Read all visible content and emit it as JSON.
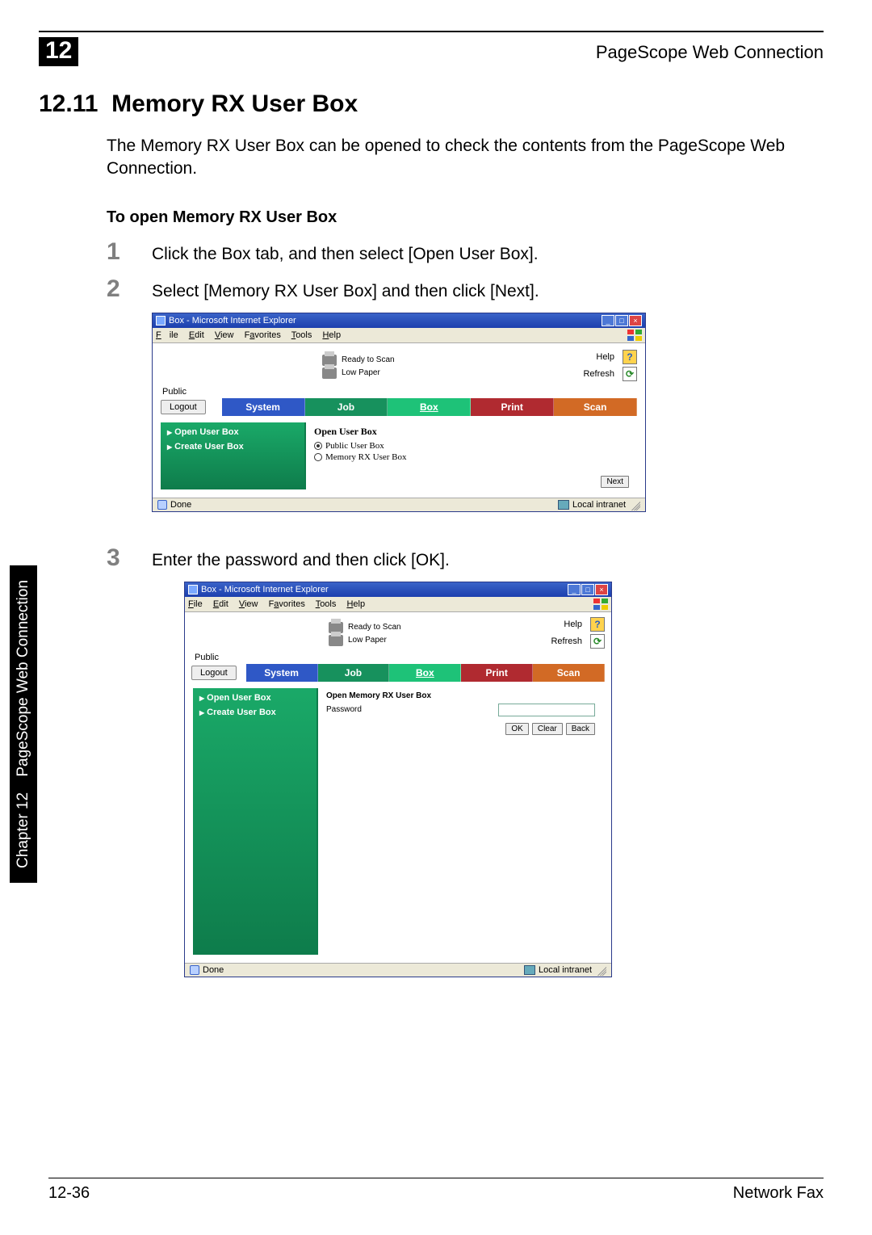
{
  "header": {
    "chapterNumber": "12",
    "right": "PageScope Web Connection"
  },
  "section": {
    "number": "12.11",
    "title": "Memory RX User Box",
    "intro": "The Memory RX User Box can be opened to check the contents from the PageScope Web Connection.",
    "subheading": "To open Memory RX User Box"
  },
  "steps": {
    "s1": {
      "num": "1",
      "text": "Click the Box tab, and then select [Open User Box]."
    },
    "s2": {
      "num": "2",
      "text": "Select [Memory RX User Box] and then click [Next]."
    },
    "s3": {
      "num": "3",
      "text": "Enter the password and then click [OK]."
    }
  },
  "browser": {
    "title": "Box - Microsoft Internet Explorer",
    "menus": {
      "file": "File",
      "edit": "Edit",
      "view": "View",
      "favorites": "Favorites",
      "tools": "Tools",
      "help": "Help"
    },
    "status": {
      "ready": "Ready to Scan",
      "lowpaper": "Low Paper"
    },
    "links": {
      "help": "Help",
      "refresh": "Refresh"
    },
    "user": "Public",
    "logout": "Logout",
    "tabs": {
      "system": "System",
      "job": "Job",
      "box": "Box",
      "print": "Print",
      "scan": "Scan"
    },
    "sidemenu": {
      "open": "Open User Box",
      "create": "Create User Box"
    },
    "statusbar": {
      "done": "Done",
      "zone": "Local intranet"
    }
  },
  "screen1": {
    "paneTitle": "Open User Box",
    "options": {
      "public": "Public User Box",
      "memory": "Memory RX User Box"
    },
    "nextBtn": "Next"
  },
  "screen2": {
    "paneTitle": "Open Memory RX User Box",
    "passwordLabel": "Password",
    "btns": {
      "ok": "OK",
      "clear": "Clear",
      "back": "Back"
    }
  },
  "sideTab": {
    "chapter": "Chapter 12",
    "title": "PageScope Web Connection"
  },
  "footer": {
    "left": "12-36",
    "right": "Network Fax"
  }
}
